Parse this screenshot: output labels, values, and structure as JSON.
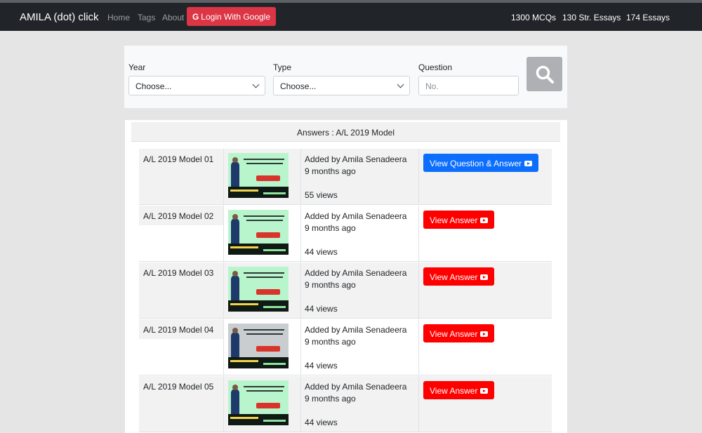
{
  "navbar": {
    "brand": "AMILA (dot) click",
    "links": [
      "Home",
      "Tags",
      "About"
    ],
    "login_label": "Login With Google",
    "stats": [
      "1300 MCQs",
      "130 Str. Essays",
      "174 Essays"
    ]
  },
  "filter": {
    "year_label": "Year",
    "year_value": "Choose...",
    "type_label": "Type",
    "type_value": "Choose...",
    "question_label": "Question",
    "question_placeholder": "No."
  },
  "answers": {
    "heading": "Answers : A/L 2019 Model",
    "rows": [
      {
        "title": "A/L 2019 Model 01",
        "added_by": "Added by Amila Senadeera",
        "age": "9 months ago",
        "views": "55 views",
        "button": "View Question & Answer",
        "button_color": "#0d6efd"
      },
      {
        "title": "A/L 2019 Model 02",
        "added_by": "Added by Amila Senadeera",
        "age": "9 months ago",
        "views": "44 views",
        "button": "View Answer",
        "button_color": "#ff0000"
      },
      {
        "title": "A/L 2019 Model 03",
        "added_by": "Added by Amila Senadeera",
        "age": "9 months ago",
        "views": "44 views",
        "button": "View Answer",
        "button_color": "#ff0000"
      },
      {
        "title": "A/L 2019 Model 04",
        "added_by": "Added by Amila Senadeera",
        "age": "9 months ago",
        "views": "44 views",
        "button": "View Answer",
        "button_color": "#ff0000"
      },
      {
        "title": "A/L 2019 Model 05",
        "added_by": "Added by Amila Senadeera",
        "age": "9 months ago",
        "views": "44 views",
        "button": "View Answer",
        "button_color": "#ff0000"
      }
    ]
  }
}
